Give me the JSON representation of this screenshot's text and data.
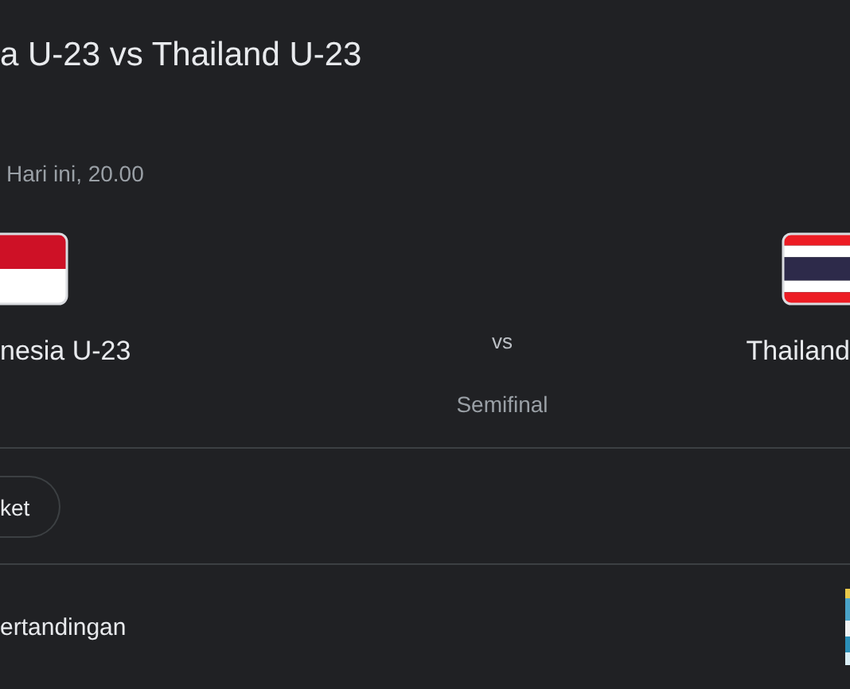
{
  "match": {
    "title": "a U-23 vs Thailand U-23",
    "time": "Hari ini, 20.00",
    "home": {
      "name": "nesia U-23",
      "kind": "indonesia"
    },
    "separator": "vs",
    "away": {
      "name": "Thailand",
      "kind": "thailand"
    },
    "stage": "Semifinal"
  },
  "action": {
    "label": "ket"
  },
  "section": {
    "label": "ertandingan",
    "kind": "picture"
  }
}
